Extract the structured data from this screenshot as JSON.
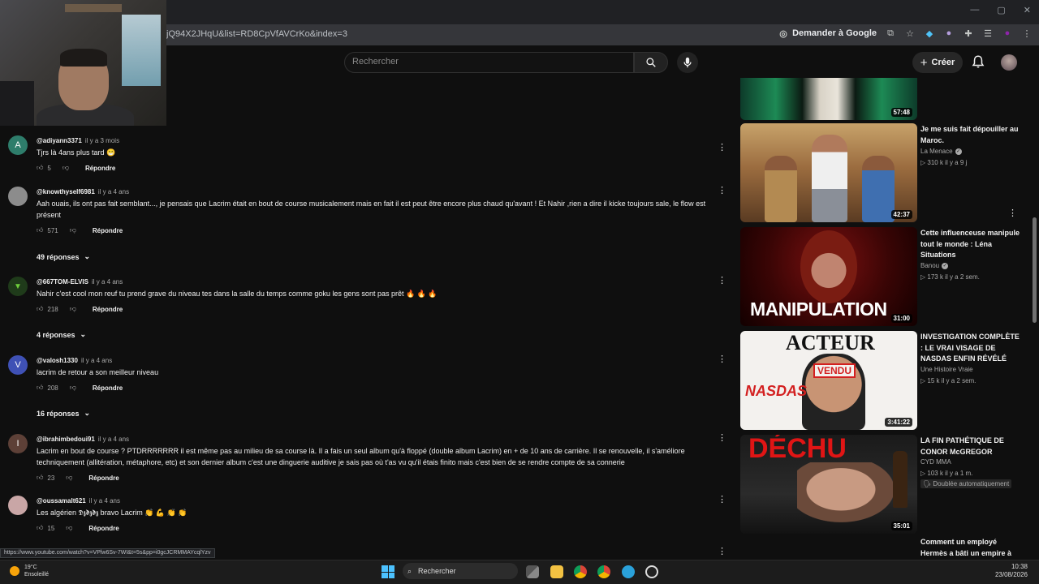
{
  "browser": {
    "url": "jQ94X2JHqU&list=RD8CpVfAVCrKo&index=3",
    "ask_google": "Demander à Google"
  },
  "header": {
    "search_placeholder": "Rechercher",
    "create_label": "Créer"
  },
  "comments": [
    {
      "avatar_letter": "A",
      "avatar_color": "#2e7d6b",
      "handle": "@adiyann3371",
      "time": "il y a 3 mois",
      "text": "Tjrs là 4ans plus tard 😁",
      "likes": "5",
      "reply": "Répondre",
      "replies": ""
    },
    {
      "avatar_letter": "",
      "avatar_color": "#8c8c8c",
      "handle": "@knowthyself6981",
      "time": "il y a 4 ans",
      "text": "Aah ouais, ils ont pas fait semblant..., je pensais que Lacrim était en bout de course musicalement mais en fait il est peut être encore plus chaud qu'avant ! Et Nahir ,rien a dire il kicke toujours sale, le flow est présent",
      "likes": "571",
      "reply": "Répondre",
      "replies": "49 réponses"
    },
    {
      "avatar_letter": "",
      "avatar_color": "#1f3b1a",
      "handle": "@667TOM-ELVIS",
      "time": "il y a 4 ans",
      "text": "Nahir c'est cool mon reuf tu prend grave du niveau tes dans la salle du temps comme goku les gens sont pas prêt 🔥 🔥 🔥",
      "likes": "218",
      "reply": "Répondre",
      "replies": "4 réponses"
    },
    {
      "avatar_letter": "V",
      "avatar_color": "#3f51b5",
      "handle": "@valosh1330",
      "time": "il y a 4 ans",
      "text": "lacrim de retour a son meilleur niveau",
      "likes": "208",
      "reply": "Répondre",
      "replies": "16 réponses"
    },
    {
      "avatar_letter": "I",
      "avatar_color": "#5d4037",
      "handle": "@ibrahimbedoui91",
      "time": "il y a 4 ans",
      "text": "Lacrim en bout de course ? PTDRRRRRRR il est même pas au milieu de sa course là. Il a fais un seul album qu'à floppé (double album Lacrim) en + de 10 ans de carrière. Il se renouvelle, il s'améliore techniquement (allitération, métaphore, etc) et son dernier album c'est une dinguerie auditive je sais pas où t'as vu qu'il étais finito mais c'est bien de se rendre compte de sa connerie",
      "likes": "23",
      "reply": "Répondre",
      "replies": ""
    },
    {
      "avatar_letter": "",
      "avatar_color": "#c9a6a6",
      "handle": "@oussamalt621",
      "time": "il y a 4 ans",
      "text": "Les algérien 𝕯𝖟𝖉𝖟𝖉𝖟 bravo Lacrim 👏 💪 👏 👏",
      "likes": "15",
      "reply": "Répondre",
      "replies": ""
    }
  ],
  "sidebar": {
    "videos": [
      {
        "title": "",
        "channel": "",
        "stats": "",
        "duration": "57:48"
      },
      {
        "title": "Je me suis fait dépouiller au Maroc.",
        "channel": "La Menace",
        "verified": true,
        "stats": "▷ 310 k  il y a 9 j",
        "duration": "42:37"
      },
      {
        "title": "Cette influenceuse manipule tout le monde : Léna Situations",
        "channel": "Banou",
        "verified": true,
        "stats": "▷ 173 k  il y a 2 sem.",
        "duration": "31:00",
        "thumb_text": "MANIPULATION"
      },
      {
        "title": "INVESTIGATION COMPLÈTE : LE VRAI VISAGE DE NASDAS ENFIN RÉVÉLÉ",
        "channel": "Une Histoire Vraie",
        "verified": false,
        "stats": "▷ 15 k  il y a 2 sem.",
        "duration": "3:41:22",
        "thumb_text_top": "ACTEUR",
        "thumb_text_left": "NASDAS",
        "thumb_text_badge": "VENDU"
      },
      {
        "title": "LA FIN PATHÉTIQUE DE CONOR McGREGOR",
        "channel": "CYD MMA",
        "verified": false,
        "stats": "▷ 103 k  il y a 1 m.",
        "badge": "Doublée automatiquement",
        "duration": "35:01",
        "thumb_text": "DÉCHU"
      },
      {
        "title": "Comment un employé Hermès a bâti un empire à",
        "channel": "",
        "stats": "",
        "duration": ""
      }
    ]
  },
  "status_url": "https://www.youtube.com/watch?v=VPlw6Sv-7WI&t=5s&pp=i0gcJCRMMAYcqlYzv",
  "taskbar": {
    "temperature": "19°C",
    "weather": "Ensoleillé",
    "search": "Rechercher",
    "time": "10:38",
    "date": "23/08/2026"
  }
}
